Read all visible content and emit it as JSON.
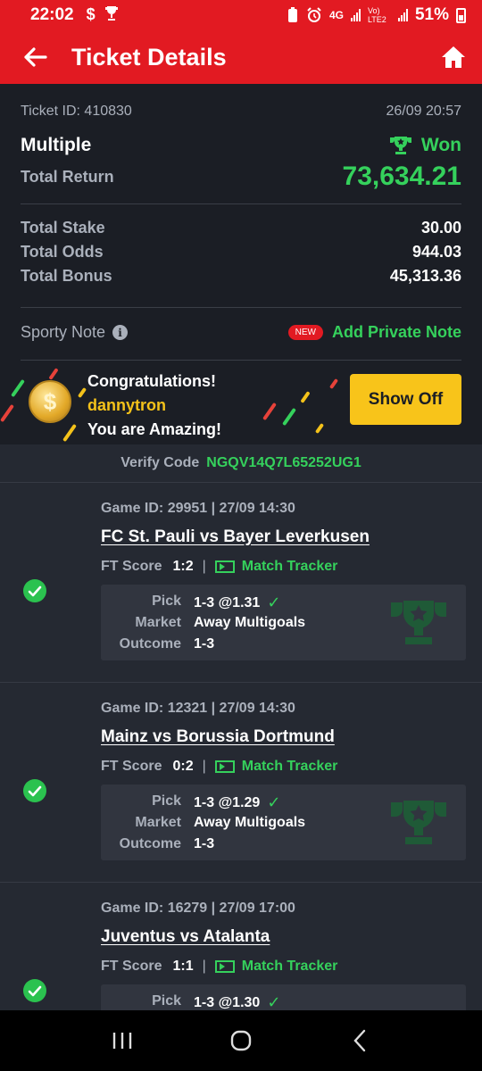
{
  "status_bar": {
    "time": "22:02",
    "battery": "51%",
    "network": "4G",
    "carrier": "Vo) LTE2"
  },
  "header": {
    "title": "Ticket Details"
  },
  "ticket": {
    "id_label": "Ticket ID: 410830",
    "datetime": "26/09 20:57",
    "type": "Multiple",
    "status": "Won",
    "total_return_label": "Total Return",
    "total_return": "73,634.21",
    "stake_label": "Total Stake",
    "stake": "30.00",
    "odds_label": "Total Odds",
    "odds": "944.03",
    "bonus_label": "Total Bonus",
    "bonus": "45,313.36"
  },
  "note": {
    "label": "Sporty Note",
    "new_badge": "NEW",
    "add_label": "Add Private Note"
  },
  "congrats": {
    "line1": "Congratulations!",
    "username": "dannytron",
    "line3": "You are Amazing!",
    "button": "Show Off"
  },
  "verify": {
    "label": "Verify Code",
    "code": "NGQV14Q7L65252UG1"
  },
  "games": [
    {
      "game_id": "Game ID: 29951 | 27/09 14:30",
      "teams": "FC St. Pauli vs Bayer Leverkusen",
      "ft_label": "FT Score",
      "score": "1:2",
      "tracker": "Match Tracker",
      "pick_label": "Pick",
      "pick": "1-3 @1.31",
      "market_label": "Market",
      "market": "Away Multigoals",
      "outcome_label": "Outcome",
      "outcome": "1-3"
    },
    {
      "game_id": "Game ID: 12321 | 27/09 14:30",
      "teams": "Mainz vs Borussia Dortmund",
      "ft_label": "FT Score",
      "score": "0:2",
      "tracker": "Match Tracker",
      "pick_label": "Pick",
      "pick": "1-3 @1.29",
      "market_label": "Market",
      "market": "Away Multigoals",
      "outcome_label": "Outcome",
      "outcome": "1-3"
    },
    {
      "game_id": "Game ID: 16279 | 27/09 17:00",
      "teams": "Juventus vs Atalanta",
      "ft_label": "FT Score",
      "score": "1:1",
      "tracker": "Match Tracker",
      "pick_label": "Pick",
      "pick": "1-3 @1.30"
    }
  ],
  "colors": {
    "brand_red": "#e21a22",
    "win_green": "#35d15c",
    "gold": "#f8c41a",
    "background": "#1b1e25"
  }
}
